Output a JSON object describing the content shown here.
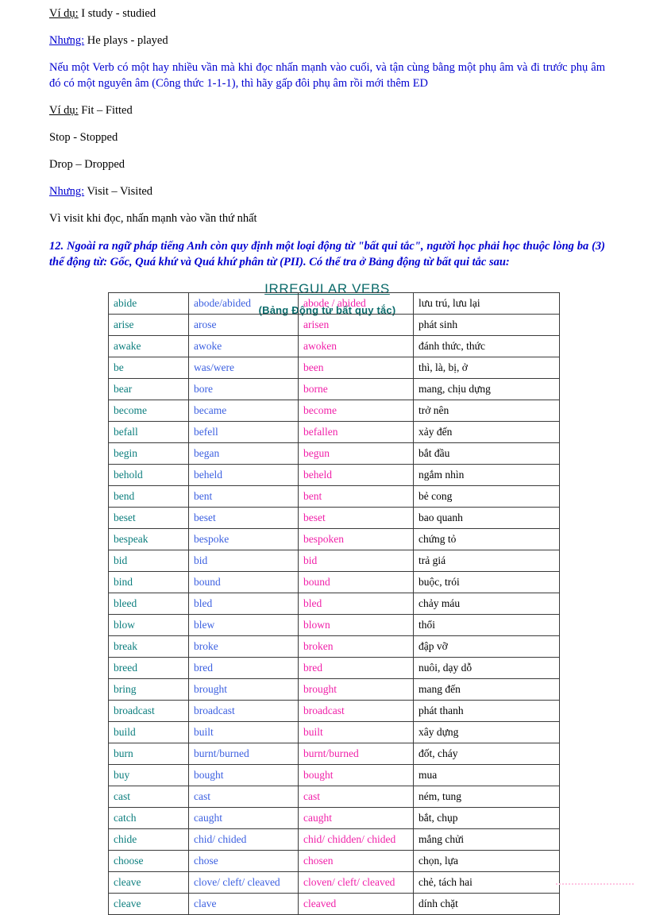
{
  "document": {
    "title": "IRREGULAR VEBS",
    "subtitle": "(Bảng Động từ bất quy tắc)",
    "colors": {
      "base_column": "#0b7d7d",
      "past_column": "#3b5fe0",
      "pp_column": "#f01fa8",
      "meaning_column": "#000000",
      "blue_text": "#0000d0",
      "heading_teal": "#0b6b6b"
    }
  },
  "intro": {
    "line1_label": "Ví dụ:",
    "line1_text": " I study  - studied",
    "line2_label": "Nhưng:",
    "line2_text": " He plays  - played",
    "rule_paragraph": "Nếu một Verb có một hay nhiều vần mà khi đọc nhấn mạnh vào cuối, và tận cùng bằng một phụ âm và đi trước phụ âm đó có một nguyên âm (Công thức 1-1-1), thì hãy gấp đôi phụ âm rồi mới thêm ED",
    "line3_label": "Ví dụ:",
    "line3_text": " Fit – Fitted",
    "line4_text": "Stop - Stopped",
    "line5_text": "Drop – Dropped",
    "line6_label": "Nhưng:",
    "line6_text": " Visit – Visited",
    "line7_text": "Vì visit  khi đọc, nhấn mạnh vào vần thứ nhất",
    "note_12": "12. Ngoài ra ngữ pháp tiếng Anh còn quy định một loại động từ \"bất qui tắc\", người học phải học thuộc lòng ba (3) thể động từ: Gốc, Quá khứ và Quá khứ phân từ (PII). Có thể tra ở Bảng động từ bất qui tắc sau:"
  },
  "table": {
    "columns": [
      "base",
      "past",
      "past_participle",
      "meaning"
    ],
    "rows": [
      [
        "abide",
        "abode/abided",
        "abode / abided",
        "lưu trú, lưu lại"
      ],
      [
        "arise",
        "arose",
        "arisen",
        "phát sinh"
      ],
      [
        "awake",
        "awoke",
        "awoken",
        "đánh thức, thức"
      ],
      [
        "be",
        "was/were",
        "been",
        "thì, là, bị, ở"
      ],
      [
        "bear",
        "bore",
        "borne",
        "mang, chịu dựng"
      ],
      [
        "become",
        "became",
        "become",
        "trở nên"
      ],
      [
        "befall",
        "befell",
        "befallen",
        "xảy đến"
      ],
      [
        "begin",
        "began",
        "begun",
        "bắt đầu"
      ],
      [
        "behold",
        "beheld",
        "beheld",
        "ngắm nhìn"
      ],
      [
        "bend",
        "bent",
        "bent",
        "bẻ cong"
      ],
      [
        "beset",
        "beset",
        "beset",
        "bao quanh"
      ],
      [
        "bespeak",
        "bespoke",
        "bespoken",
        "chứng tỏ"
      ],
      [
        "bid",
        "bid",
        "bid",
        "trả giá"
      ],
      [
        "bind",
        "bound",
        "bound",
        "buộc, trói"
      ],
      [
        "bleed",
        "bled",
        "bled",
        "chảy máu"
      ],
      [
        "blow",
        "blew",
        "blown",
        "thổi"
      ],
      [
        "break",
        "broke",
        "broken",
        "đập vỡ"
      ],
      [
        "breed",
        "bred",
        "bred",
        "nuôi, dạy dỗ"
      ],
      [
        "bring",
        "brought",
        "brought",
        "mang đến"
      ],
      [
        "broadcast",
        "broadcast",
        "broadcast",
        "phát thanh"
      ],
      [
        "build",
        "built",
        "built",
        "xây dựng"
      ],
      [
        "burn",
        "burnt/burned",
        "burnt/burned",
        "đốt, cháy"
      ],
      [
        "buy",
        "bought",
        "bought",
        "mua"
      ],
      [
        "cast",
        "cast",
        "cast",
        "ném, tung"
      ],
      [
        "catch",
        "caught",
        "caught",
        "bắt, chụp"
      ],
      [
        "chide",
        "chid/ chided",
        "chid/ chidden/ chided",
        "mắng chửi"
      ],
      [
        "choose",
        "chose",
        "chosen",
        "chọn, lựa"
      ],
      [
        "cleave",
        "clove/ cleft/ cleaved",
        "cloven/ cleft/ cleaved",
        "chẻ, tách hai"
      ],
      [
        "cleave",
        "clave",
        "cleaved",
        "dính chặt"
      ]
    ]
  }
}
